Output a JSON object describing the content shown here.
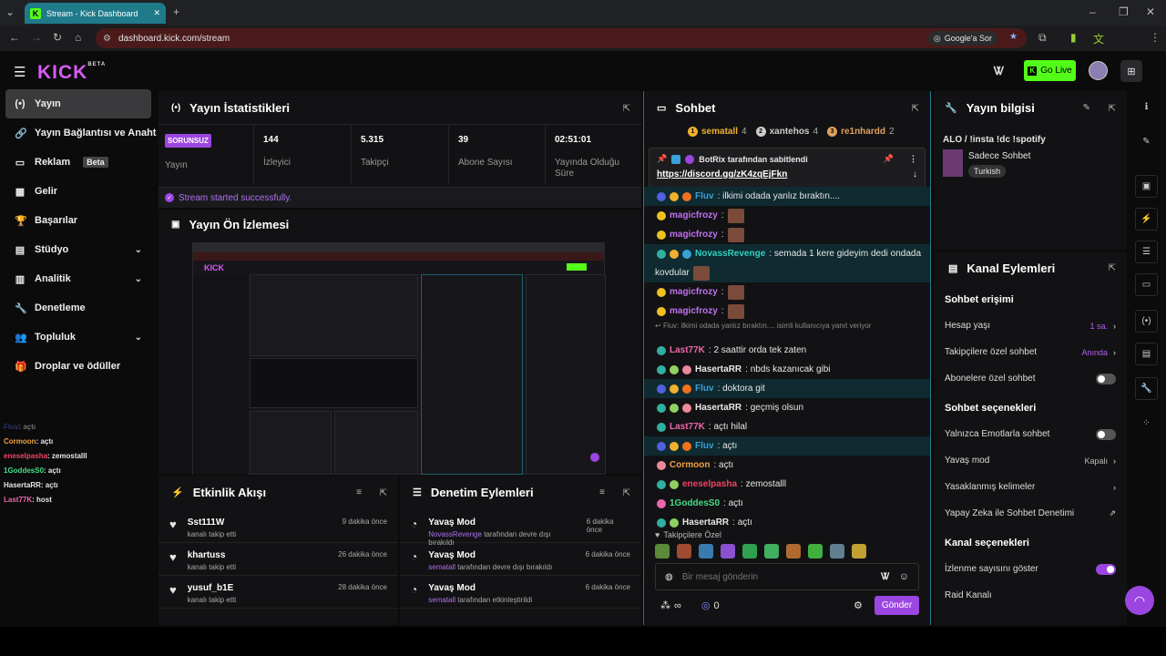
{
  "browser": {
    "tab_title": "Stream - Kick Dashboard",
    "url": "dashboard.kick.com/stream",
    "google_ask": "Google'a Sor"
  },
  "header": {
    "logo": "KICK",
    "logo_badge": "BETA",
    "go_live": "Go Live"
  },
  "sidebar": {
    "items": [
      {
        "label": "Yayın",
        "icon": "broadcast-icon"
      },
      {
        "label": "Yayın Bağlantısı ve Anahtarı",
        "icon": "link-icon"
      },
      {
        "label": "Reklam",
        "icon": "ad-icon",
        "badge": "Beta"
      },
      {
        "label": "Gelir",
        "icon": "chart-icon"
      },
      {
        "label": "Başarılar",
        "icon": "trophy-icon"
      },
      {
        "label": "Stüdyo",
        "icon": "studio-icon"
      },
      {
        "label": "Analitik",
        "icon": "analytics-icon"
      },
      {
        "label": "Denetleme",
        "icon": "wrench-icon"
      },
      {
        "label": "Topluluk",
        "icon": "community-icon"
      },
      {
        "label": "Droplar ve ödüller",
        "icon": "gift-icon"
      }
    ],
    "mini_chat": [
      {
        "user": "Fluv",
        "msg": ": açtı",
        "color": "#3a6ad8"
      },
      {
        "user": "Cormoon",
        "msg": ": açtı",
        "color": "#f0a040"
      },
      {
        "user": "eneselpasha",
        "msg": ": zemostalll",
        "color": "#ee4466"
      },
      {
        "user": "1GoddesS0",
        "msg": ": açtı",
        "color": "#44dd88"
      },
      {
        "user": "HasertaRR",
        "msg": ": açtı",
        "color": "#e8e8e8"
      },
      {
        "user": "Last77K",
        "msg": ": host",
        "color": "#ee66aa"
      }
    ]
  },
  "stats": {
    "title": "Yayın İstatistikleri",
    "status_badge": "SORUNSUZ",
    "status_label": "Yayın",
    "cells": [
      {
        "value": "144",
        "label": "İzleyici"
      },
      {
        "value": "5.315",
        "label": "Takipçi"
      },
      {
        "value": "39",
        "label": "Abone Sayısı"
      },
      {
        "value": "02:51:01",
        "label": "Yayında Olduğu Süre"
      }
    ],
    "success_msg": "Stream started successfully."
  },
  "preview": {
    "title": "Yayın Ön İzlemesi"
  },
  "activity": {
    "title": "Etkinlik Akışı",
    "items": [
      {
        "user": "Sst111W",
        "action": "kanalı takip etti",
        "time": "9 dakika önce"
      },
      {
        "user": "khartuss",
        "action": "kanalı takip etti",
        "time": "26 dakika önce"
      },
      {
        "user": "yusuf_b1E",
        "action": "kanalı takip etti",
        "time": "28 dakika önce"
      }
    ]
  },
  "moderation": {
    "title": "Denetim Eylemleri",
    "items": [
      {
        "title": "Yavaş Mod",
        "user": "NovassRevenge",
        "action": "tarafından devre dışı bırakıldı",
        "time": "6 dakika önce"
      },
      {
        "title": "Yavaş Mod",
        "user": "sematall",
        "action": "tarafından devre dışı bırakıldı",
        "time": "6 dakika önce"
      },
      {
        "title": "Yavaş Mod",
        "user": "sematall",
        "action": "tarafından etkinleştirildi",
        "time": "6 dakika önce"
      }
    ]
  },
  "chat": {
    "title": "Sohbet",
    "top_chatters": [
      {
        "rank": "1",
        "name": "sematall",
        "count": "4",
        "color": "#f0b030"
      },
      {
        "rank": "2",
        "name": "xantehos",
        "count": "4",
        "color": "#cccccc"
      },
      {
        "rank": "3",
        "name": "re1nhardd",
        "count": "2",
        "color": "#e0a060"
      }
    ],
    "pinned_by": "BotRix tarafından sabitlendi",
    "pinned_link": "https://discord.gg/zK4zqEjFkn",
    "messages": [
      {
        "user": "Fluv",
        "text": ": ilkimi odada yanlız bıraktın....",
        "color": "#3aa0d8",
        "hl": true,
        "badges": [
          "#5060e0",
          "#f0b030",
          "#f07020"
        ],
        "emote": false
      },
      {
        "user": "magicfrozy",
        "text": ":",
        "color": "#c070f0",
        "hl": false,
        "badges": [
          "#f0c020"
        ],
        "emote": true
      },
      {
        "user": "magicfrozy",
        "text": ":",
        "color": "#c070f0",
        "hl": false,
        "badges": [
          "#f0c020"
        ],
        "emote": true
      },
      {
        "user": "NovassRevenge",
        "text": ": semada 1 kere gideyim dedi ondada",
        "color": "#30d0c0",
        "hl": true,
        "badges": [
          "#30b0a0",
          "#f0b030",
          "#3aa0d8"
        ],
        "emote": false
      },
      {
        "user": "",
        "text": "kovdular",
        "color": "#ffffff",
        "hl": true,
        "badges": [],
        "emote": true
      },
      {
        "user": "magicfrozy",
        "text": ":",
        "color": "#c070f0",
        "hl": false,
        "badges": [
          "#f0c020"
        ],
        "emote": true
      },
      {
        "user": "magicfrozy",
        "text": ":",
        "color": "#c070f0",
        "hl": false,
        "badges": [
          "#f0c020"
        ],
        "emote": true
      },
      {
        "user": "Last77K",
        "text": ": 2 saattir orda tek zaten",
        "color": "#ee66aa",
        "hl": false,
        "badges": [
          "#30b0a0"
        ],
        "emote": false
      },
      {
        "user": "HasertaRR",
        "text": ": nbds kazanıcak gibi",
        "color": "#e8e8e8",
        "hl": false,
        "badges": [
          "#30b0a0",
          "#90d060",
          "#ee8899"
        ],
        "emote": false
      },
      {
        "user": "Fluv",
        "text": ": doktora git",
        "color": "#3aa0d8",
        "hl": true,
        "badges": [
          "#5060e0",
          "#f0b030",
          "#f07020"
        ],
        "emote": false
      },
      {
        "user": "HasertaRR",
        "text": ": geçmiş olsun",
        "color": "#e8e8e8",
        "hl": false,
        "badges": [
          "#30b0a0",
          "#90d060",
          "#ee8899"
        ],
        "emote": false
      },
      {
        "user": "Last77K",
        "text": ": açtı hilal",
        "color": "#ee66aa",
        "hl": false,
        "badges": [
          "#30b0a0"
        ],
        "emote": false
      },
      {
        "user": "Fluv",
        "text": ": açtı",
        "color": "#3aa0d8",
        "hl": true,
        "badges": [
          "#5060e0",
          "#f0b030",
          "#f07020"
        ],
        "emote": false
      },
      {
        "user": "Cormoon",
        "text": ": açtı",
        "color": "#f0a040",
        "hl": false,
        "badges": [
          "#ee8899"
        ],
        "emote": false
      },
      {
        "user": "eneselpasha",
        "text": ": zemostalll",
        "color": "#ee4466",
        "hl": false,
        "badges": [
          "#30b0a0",
          "#90d060"
        ],
        "emote": false
      },
      {
        "user": "1GoddesS0",
        "text": ": açtı",
        "color": "#44dd88",
        "hl": false,
        "badges": [
          "#ee66aa"
        ],
        "emote": false
      },
      {
        "user": "HasertaRR",
        "text": ": açtı",
        "color": "#e8e8e8",
        "hl": false,
        "badges": [
          "#30b0a0",
          "#90d060"
        ],
        "emote": false
      }
    ],
    "reply_hint": "Fluv: ilkimi odada yanlız bıraktın.... isimli kullanıcıya yanıt veriyor",
    "followers_only": "Takipçilere Özel",
    "input_placeholder": "Bir mesaj gönderin",
    "send": "Gönder",
    "infinity": "∞",
    "points": "0"
  },
  "stream_info": {
    "title": "Yayın bilgisi",
    "stream_title": "ALO / !insta !dc !spotify",
    "category": "Sadece Sohbet",
    "language": "Turkish"
  },
  "channel_actions": {
    "title": "Kanal Eylemleri",
    "chat_access": "Sohbet erişimi",
    "account_age": "Hesap yaşı",
    "account_age_val": "1 sa.",
    "followers_chat": "Takipçilere özel sohbet",
    "followers_chat_val": "Anında",
    "subs_chat": "Abonelere özel sohbet",
    "chat_options": "Sohbet seçenekleri",
    "emote_only": "Yalnızca Emotlarla sohbet",
    "slow_mode": "Yavaş mod",
    "slow_mode_val": "Kapalı",
    "banned_words": "Yasaklanmış kelimeler",
    "ai_moderation": "Yapay Zeka ile Sohbet Denetimi",
    "channel_options": "Kanal seçenekleri",
    "show_viewers": "İzlenme sayısını göster",
    "raid": "Raid Kanalı"
  },
  "colors": {
    "kick_green": "#53fc18",
    "accent_purple": "#9b46e0",
    "panel_bg": "#121214"
  }
}
